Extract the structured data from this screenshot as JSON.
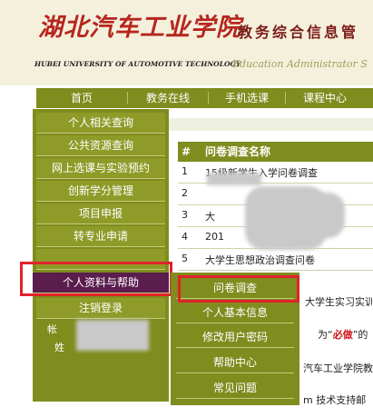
{
  "header": {
    "logo_cn": "湖北汽车工业学院",
    "logo_en": "HUBEI UNIVERSITY OF AUTOMOTIVE TECHNOLOGY",
    "system_cn": "教务综合信息管",
    "system_en": "Education Administrator S"
  },
  "nav": {
    "items": [
      "首页",
      "教务在线",
      "手机选课",
      "课程中心"
    ]
  },
  "sidebar": {
    "items": [
      "个人相关查询",
      "公共资源查询",
      "网上选课与实验预约",
      "创新学分管理",
      "项目申报",
      "转专业申请",
      "",
      "个人资料与帮助",
      "注销登录"
    ],
    "info_prefix1": "帐",
    "info_prefix2": "姓"
  },
  "survey_table": {
    "col_num": "#",
    "col_name": "问卷调查名称",
    "rows": [
      {
        "num": "1",
        "name": "15级新学生入学问卷调查"
      },
      {
        "num": "2",
        "name": ""
      },
      {
        "num": "3",
        "name": "大"
      },
      {
        "num": "4",
        "name": "201"
      },
      {
        "num": "5",
        "name": "大学生思想政治调查问卷"
      }
    ]
  },
  "dropdown": {
    "items": [
      "问卷调查",
      "个人基本信息",
      "修改用户密码",
      "帮助中心",
      "常见问题"
    ]
  },
  "right_texts": {
    "t1": "大学生实习实训",
    "t2": "为“必做”的",
    "t3": "汽车工业学院教",
    "t4": "m 技术支持邮"
  }
}
